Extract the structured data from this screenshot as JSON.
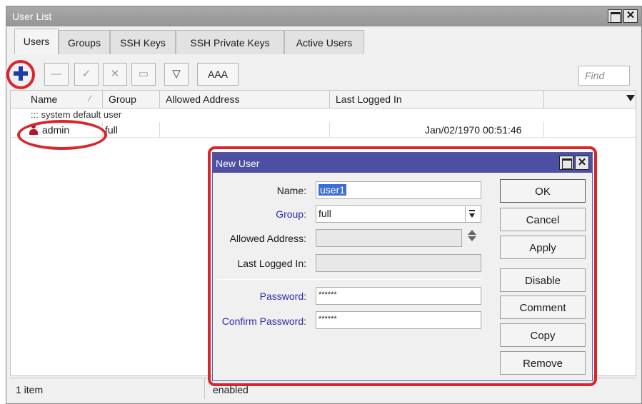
{
  "window": {
    "title": "User List"
  },
  "tabs": [
    {
      "label": "Users"
    },
    {
      "label": "Groups"
    },
    {
      "label": "SSH Keys"
    },
    {
      "label": "SSH Private Keys"
    },
    {
      "label": "Active Users"
    }
  ],
  "toolbar": {
    "add_icon": "plus-icon",
    "aaa_label": "AAA",
    "find_placeholder": "Find"
  },
  "table": {
    "columns": [
      "Name",
      "Group",
      "Allowed Address",
      "Last Logged In"
    ],
    "comment": "::: system default user",
    "rows": [
      {
        "name": "admin",
        "group": "full",
        "allowed_address": "",
        "last_logged_in": "Jan/02/1970 00:51:46"
      }
    ]
  },
  "status": {
    "count": "1 item",
    "state": "enabled"
  },
  "dialog": {
    "title": "New User",
    "name_label": "Name:",
    "name_value": "user1",
    "group_label": "Group:",
    "group_value": "full",
    "allowed_label": "Allowed Address:",
    "last_label": "Last Logged In:",
    "password_label": "Password:",
    "password_value": "******",
    "confirm_label": "Confirm Password:",
    "confirm_value": "******",
    "buttons": [
      "OK",
      "Cancel",
      "Apply",
      "Disable",
      "Comment",
      "Copy",
      "Remove"
    ]
  },
  "colors": {
    "highlight_red": "#d9252e",
    "dialog_title": "#4d4fa3",
    "label_blue": "#2a2aa8"
  }
}
